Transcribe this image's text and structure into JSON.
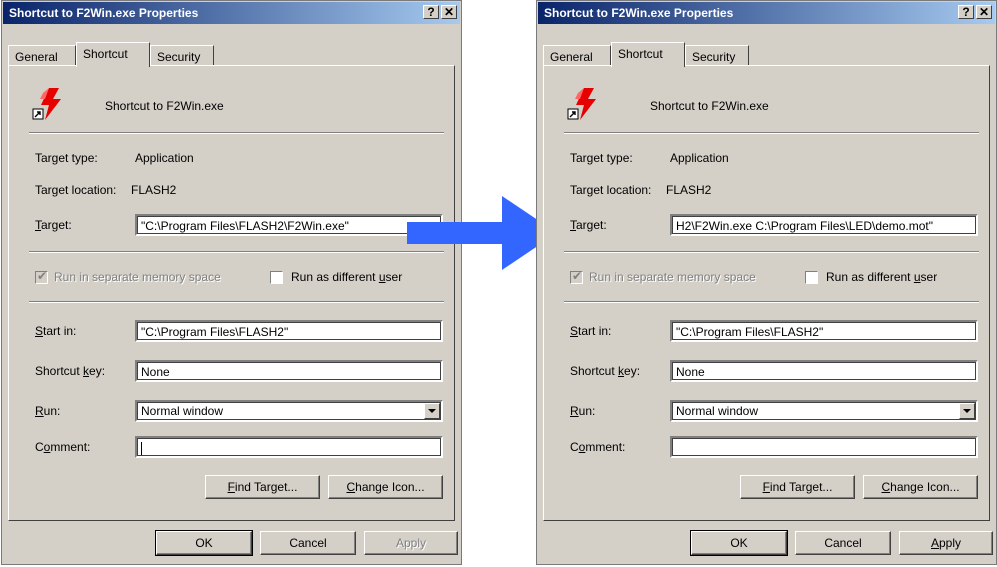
{
  "left_dialog": {
    "title": "Shortcut to F2Win.exe Properties",
    "help_label": "?",
    "close_label": "✕",
    "tabs": [
      "General",
      "Shortcut",
      "Security"
    ],
    "shortcut_name": "Shortcut to F2Win.exe",
    "target_type_label": "Target type:",
    "target_type_value": "Application",
    "target_location_label": "Target location:",
    "target_location_value": "FLASH2",
    "target_label_pre": "",
    "target_label_key": "T",
    "target_label_post": "arget:",
    "target_value": "\"C:\\Program Files\\FLASH2\\F2Win.exe\"",
    "run_separate_label": "Run in separate memory space",
    "run_as_label_pre": "Run as different ",
    "run_as_label_key": "u",
    "run_as_label_post": "ser",
    "start_in_label_pre": "",
    "start_in_label_key": "S",
    "start_in_label_post": "tart in:",
    "start_in_value": "\"C:\\Program Files\\FLASH2\"",
    "shortcut_key_label_pre": "Shortcut ",
    "shortcut_key_label_key": "k",
    "shortcut_key_label_post": "ey:",
    "shortcut_key_value": "None",
    "run_label_pre": "",
    "run_label_key": "R",
    "run_label_post": "un:",
    "run_value": "Normal window",
    "comment_label_pre": "C",
    "comment_label_key": "o",
    "comment_label_post": "mment:",
    "comment_value": "",
    "find_target_pre": "",
    "find_target_key": "F",
    "find_target_post": "ind Target...",
    "change_icon_pre": "",
    "change_icon_key": "C",
    "change_icon_post": "hange Icon...",
    "ok_label": "OK",
    "cancel_label": "Cancel",
    "apply_label": "Apply",
    "apply_enabled": false
  },
  "right_dialog": {
    "title": "Shortcut to F2Win.exe Properties",
    "help_label": "?",
    "close_label": "✕",
    "tabs": [
      "General",
      "Shortcut",
      "Security"
    ],
    "shortcut_name": "Shortcut to F2Win.exe",
    "target_type_label": "Target type:",
    "target_type_value": "Application",
    "target_location_label": "Target location:",
    "target_location_value": "FLASH2",
    "target_label_pre": "",
    "target_label_key": "T",
    "target_label_post": "arget:",
    "target_value": "H2\\F2Win.exe C:\\Program Files\\LED\\demo.mot\"",
    "run_separate_label": "Run in separate memory space",
    "run_as_label_pre": "Run as different ",
    "run_as_label_key": "u",
    "run_as_label_post": "ser",
    "start_in_label_pre": "",
    "start_in_label_key": "S",
    "start_in_label_post": "tart in:",
    "start_in_value": "\"C:\\Program Files\\FLASH2\"",
    "shortcut_key_label_pre": "Shortcut ",
    "shortcut_key_label_key": "k",
    "shortcut_key_label_post": "ey:",
    "shortcut_key_value": "None",
    "run_label_pre": "",
    "run_label_key": "R",
    "run_label_post": "un:",
    "run_value": "Normal window",
    "comment_label_pre": "C",
    "comment_label_key": "o",
    "comment_label_post": "mment:",
    "comment_value": "",
    "find_target_pre": "",
    "find_target_key": "F",
    "find_target_post": "ind Target...",
    "change_icon_pre": "",
    "change_icon_key": "C",
    "change_icon_post": "hange Icon...",
    "ok_label": "OK",
    "cancel_label": "Cancel",
    "apply_label_pre": "",
    "apply_label_key": "A",
    "apply_label_post": "pply",
    "apply_enabled": true
  },
  "arrow": {
    "color": "#3366ff",
    "icon": "right-arrow-icon"
  },
  "colors": {
    "title_start": "#0a246a",
    "title_end": "#a6caf0",
    "dialog_bg": "#d4d0c8"
  }
}
